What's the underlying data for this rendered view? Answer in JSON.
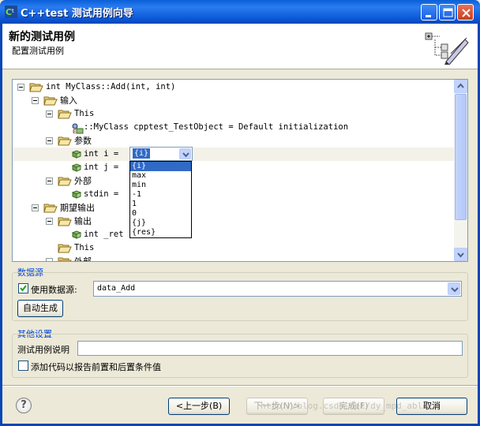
{
  "window": {
    "title": "C++test 测试用例向导"
  },
  "header": {
    "title": "新的测试用例",
    "subtitle": "配置测试用例"
  },
  "tree": [
    {
      "text": "int MyClass::Add(int, int)",
      "level": 0,
      "type": "folder",
      "toggle": true,
      "cjk": false
    },
    {
      "text": "输入",
      "level": 1,
      "type": "folder",
      "toggle": true,
      "cjk": true
    },
    {
      "text": "This",
      "level": 2,
      "type": "folder",
      "toggle": true,
      "cjk": false
    },
    {
      "text": "::MyClass cpptest_TestObject = Default initialization",
      "level": 3,
      "type": "leaf-obj",
      "toggle": false,
      "cjk": false
    },
    {
      "text": "参数",
      "level": 2,
      "type": "folder",
      "toggle": true,
      "cjk": true
    },
    {
      "text": "int i =",
      "level": 3,
      "type": "leaf",
      "toggle": false,
      "cjk": false,
      "selected": true
    },
    {
      "text": "int j =",
      "level": 3,
      "type": "leaf",
      "toggle": false,
      "cjk": false
    },
    {
      "text": "外部",
      "level": 2,
      "type": "folder",
      "toggle": true,
      "cjk": true
    },
    {
      "text": "stdin =",
      "level": 3,
      "type": "leaf",
      "toggle": false,
      "cjk": false
    },
    {
      "text": "期望输出",
      "level": 1,
      "type": "folder",
      "toggle": true,
      "cjk": true
    },
    {
      "text": "输出",
      "level": 2,
      "type": "folder",
      "toggle": true,
      "cjk": true
    },
    {
      "text": "int _ret",
      "level": 3,
      "type": "leaf",
      "toggle": false,
      "cjk": false
    },
    {
      "text": "This",
      "level": 2,
      "type": "folder",
      "toggle": false,
      "cjk": false
    },
    {
      "text": "外部",
      "level": 2,
      "type": "folder",
      "toggle": true,
      "cjk": true
    }
  ],
  "combo": {
    "value": "{i}",
    "options": [
      "{i}",
      "max",
      "min",
      "-1",
      "1",
      "0",
      "{j}",
      "{res}"
    ]
  },
  "datasource": {
    "group_title": "数据源",
    "use_label": "使用数据源:",
    "use_checked": true,
    "selected": "data_Add",
    "autogen_label": "自动生成"
  },
  "other": {
    "group_title": "其他设置",
    "desc_label": "测试用例说明",
    "desc_value": "",
    "add_code_label": "添加代码以报告前置和后置条件值",
    "add_code_checked": false
  },
  "buttons": {
    "back": "<上一步(B)",
    "next": "下一步(N)>",
    "finish": "完成(F)",
    "cancel": "取消"
  },
  "watermark": "http://blog.csdn.net/dy_mpd_ablock"
}
